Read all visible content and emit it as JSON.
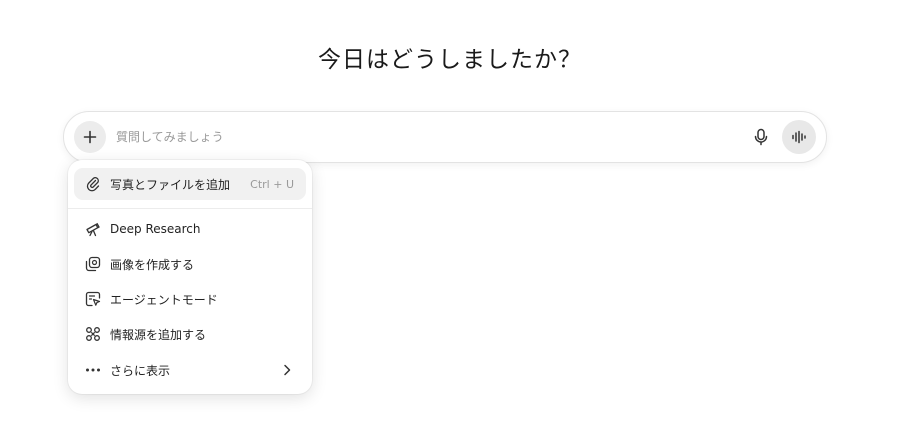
{
  "heading": "今日はどうしましたか？",
  "composer": {
    "placeholder": "質問してみましょう",
    "plus_icon": "plus-icon",
    "mic_icon": "microphone-icon",
    "voice_icon": "voice-mode-icon"
  },
  "menu": {
    "items": [
      {
        "label": "写真とファイルを追加",
        "shortcut": "Ctrl + U",
        "icon": "paperclip-icon"
      },
      {
        "label": "Deep Research",
        "icon": "telescope-icon"
      },
      {
        "label": "画像を作成する",
        "icon": "image-create-icon"
      },
      {
        "label": "エージェントモード",
        "icon": "agent-cursor-icon"
      },
      {
        "label": "情報源を追加する",
        "icon": "connectors-icon"
      },
      {
        "label": "さらに表示",
        "icon": "ellipsis-icon"
      }
    ]
  }
}
